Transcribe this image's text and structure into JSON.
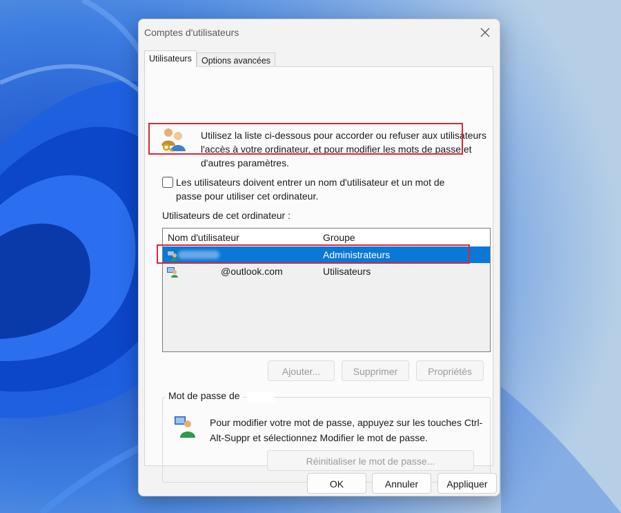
{
  "window": {
    "title": "Comptes d'utilisateurs"
  },
  "tabs": [
    {
      "label": "Utilisateurs",
      "active": true
    },
    {
      "label": "Options avancées",
      "active": false
    }
  ],
  "intro_text": "Utilisez la liste ci-dessous pour accorder ou refuser aux utilisateurs l'accès à votre ordinateur, et pour modifier les mots de passe et d'autres paramètres.",
  "require_login": {
    "label": "Les utilisateurs doivent entrer un nom d'utilisateur et un mot de passe pour utiliser cet ordinateur.",
    "checked": false
  },
  "users_section": {
    "label": "Utilisateurs de cet ordinateur :",
    "columns": [
      "Nom d'utilisateur",
      "Groupe"
    ],
    "rows": [
      {
        "name": "",
        "group": "Administrateurs",
        "selected": true
      },
      {
        "name": "@outlook.com",
        "group": "Utilisateurs",
        "selected": false
      }
    ]
  },
  "list_buttons": {
    "add": "Ajouter...",
    "remove": "Supprimer",
    "properties": "Propriétés"
  },
  "password_group": {
    "title": "Mot de passe de",
    "text": "Pour modifier votre mot de passe, appuyez sur les touches Ctrl-Alt-Suppr et sélectionnez Modifier le mot de passe.",
    "reset_button": "Réinitialiser le mot de passe..."
  },
  "footer_buttons": {
    "ok": "OK",
    "cancel": "Annuler",
    "apply": "Appliquer"
  },
  "colors": {
    "selection": "#0a78d7",
    "highlight_box": "#d6283a",
    "wallpaper": "#1f5fd8"
  },
  "icons": [
    "close-icon",
    "users-keys-icon",
    "user-icon",
    "user-password-icon",
    "checkbox"
  ]
}
